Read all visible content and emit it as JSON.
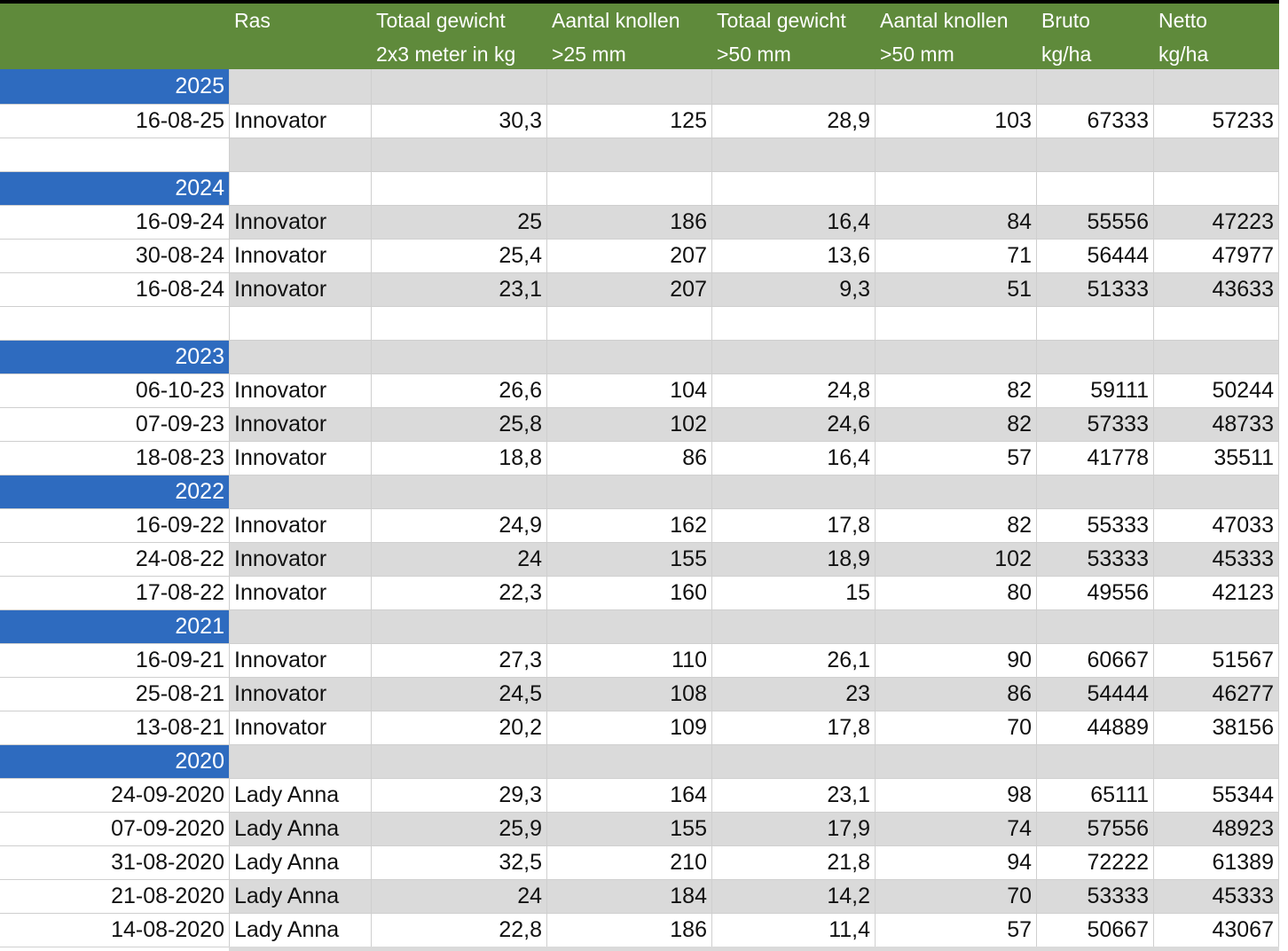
{
  "header": {
    "col1": [
      "",
      ""
    ],
    "col2": [
      "Ras",
      ""
    ],
    "col3": [
      "Totaal gewicht",
      "2x3 meter in kg"
    ],
    "col4": [
      "Aantal knollen",
      ">25 mm"
    ],
    "col5": [
      "Totaal gewicht",
      ">50 mm"
    ],
    "col6": [
      "Aantal knollen",
      ">50 mm"
    ],
    "col7": [
      "Bruto",
      "kg/ha"
    ],
    "col8": [
      "Netto",
      "kg/ha"
    ]
  },
  "rows": [
    {
      "type": "year",
      "label": "2025"
    },
    {
      "type": "data",
      "cells": [
        "16-08-25",
        "Innovator",
        "30,3",
        "125",
        "28,9",
        "103",
        "67333",
        "57233"
      ]
    },
    {
      "type": "blank"
    },
    {
      "type": "year",
      "label": "2024"
    },
    {
      "type": "data",
      "cells": [
        "16-09-24",
        "Innovator",
        "25",
        "186",
        "16,4",
        "84",
        "55556",
        "47223"
      ]
    },
    {
      "type": "data",
      "cells": [
        "30-08-24",
        "Innovator",
        "25,4",
        "207",
        "13,6",
        "71",
        "56444",
        "47977"
      ]
    },
    {
      "type": "data",
      "cells": [
        "16-08-24",
        "Innovator",
        "23,1",
        "207",
        "9,3",
        "51",
        "51333",
        "43633"
      ]
    },
    {
      "type": "blank"
    },
    {
      "type": "year",
      "label": "2023"
    },
    {
      "type": "data",
      "cells": [
        "06-10-23",
        "Innovator",
        "26,6",
        "104",
        "24,8",
        "82",
        "59111",
        "50244"
      ]
    },
    {
      "type": "data",
      "cells": [
        "07-09-23",
        "Innovator",
        "25,8",
        "102",
        "24,6",
        "82",
        "57333",
        "48733"
      ]
    },
    {
      "type": "data",
      "cells": [
        "18-08-23",
        "Innovator",
        "18,8",
        "86",
        "16,4",
        "57",
        "41778",
        "35511"
      ]
    },
    {
      "type": "year",
      "label": "2022"
    },
    {
      "type": "data",
      "cells": [
        "16-09-22",
        "Innovator",
        "24,9",
        "162",
        "17,8",
        "82",
        "55333",
        "47033"
      ]
    },
    {
      "type": "data",
      "cells": [
        "24-08-22",
        "Innovator",
        "24",
        "155",
        "18,9",
        "102",
        "53333",
        "45333"
      ]
    },
    {
      "type": "data",
      "cells": [
        "17-08-22",
        "Innovator",
        "22,3",
        "160",
        "15",
        "80",
        "49556",
        "42123"
      ]
    },
    {
      "type": "year",
      "label": "2021"
    },
    {
      "type": "data",
      "cells": [
        "16-09-21",
        "Innovator",
        "27,3",
        "110",
        "26,1",
        "90",
        "60667",
        "51567"
      ]
    },
    {
      "type": "data",
      "cells": [
        "25-08-21",
        "Innovator",
        "24,5",
        "108",
        "23",
        "86",
        "54444",
        "46277"
      ]
    },
    {
      "type": "data",
      "cells": [
        "13-08-21",
        "Innovator",
        "20,2",
        "109",
        "17,8",
        "70",
        "44889",
        "38156"
      ]
    },
    {
      "type": "year",
      "label": "2020"
    },
    {
      "type": "data",
      "cells": [
        "24-09-2020",
        "Lady Anna",
        "29,3",
        "164",
        "23,1",
        "98",
        "65111",
        "55344"
      ]
    },
    {
      "type": "data",
      "cells": [
        "07-09-2020",
        "Lady Anna",
        "25,9",
        "155",
        "17,9",
        "74",
        "57556",
        "48923"
      ]
    },
    {
      "type": "data",
      "cells": [
        "31-08-2020",
        "Lady Anna",
        "32,5",
        "210",
        "21,8",
        "94",
        "72222",
        "61389"
      ]
    },
    {
      "type": "data",
      "cells": [
        "21-08-2020",
        "Lady Anna",
        "24",
        "184",
        "14,2",
        "70",
        "53333",
        "45333"
      ]
    },
    {
      "type": "data",
      "cells": [
        "14-08-2020",
        "Lady Anna",
        "22,8",
        "186",
        "11,4",
        "57",
        "50667",
        "43067"
      ]
    }
  ]
}
